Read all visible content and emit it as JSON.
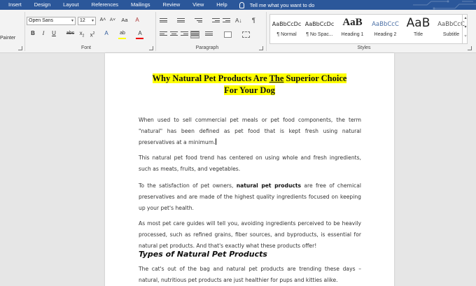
{
  "menu": {
    "tabs": [
      "Insert",
      "Design",
      "Layout",
      "References",
      "Mailings",
      "Review",
      "View",
      "Help"
    ],
    "tell_me": "Tell me what you want to do"
  },
  "ribbon": {
    "painter_label": "Painter",
    "font": {
      "group_label": "Font",
      "family": "Open Sans",
      "size": "12",
      "grow": "A˄",
      "shrink": "A˅",
      "case": "Aa",
      "clear": "A",
      "bold": "B",
      "italic": "I",
      "underline": "U",
      "strike": "abc",
      "subscript_base": "x",
      "subscript": "2",
      "superscript": "2",
      "text_effects": "A",
      "highlight": "ab",
      "font_color": "A"
    },
    "paragraph": {
      "group_label": "Paragraph",
      "sort": "A↓",
      "pilcrow": "¶"
    },
    "styles": {
      "group_label": "Styles",
      "items": [
        {
          "sample": "AaBbCcDc",
          "name": "¶ Normal"
        },
        {
          "sample": "AaBbCcDc",
          "name": "¶ No Spac..."
        },
        {
          "sample": "AaB",
          "name": "Heading 1"
        },
        {
          "sample": "AaBbCcC",
          "name": "Heading 2"
        },
        {
          "sample": "AaB",
          "name": "Title"
        },
        {
          "sample": "AaBbCcC",
          "name": "Subtitle"
        }
      ]
    }
  },
  "colors": {
    "accent": "#2b579a",
    "highlight": "#ffff00",
    "font_color": "#e00000"
  },
  "document": {
    "title_line1_a": "Why Natural Pet Products Are ",
    "title_line1_u": "The",
    "title_line1_b": " Superior Choice",
    "title_line2": "For Your Dog",
    "p1": "When used to sell commercial pet meals or pet food components, the term \"natural\" has been defined as pet food that is kept fresh using natural preservatives at a minimum.",
    "p2": "This natural pet food trend has centered on using whole and fresh ingredients, such as meats, fruits, and vegetables.",
    "p3_a": "To the satisfaction of pet owners, ",
    "p3_b": "natural pet products",
    "p3_c": " are free of chemical preservatives and are made of the highest quality ingredients focused on keeping up your pet's health.",
    "p4": "As most pet care guides will tell you, avoiding ingredients perceived to be heavily processed, such as refined grains, fiber sources, and byproducts, is essential for natural pet products. And that's exactly what these products offer!",
    "h2": "Types of Natural Pet Products",
    "p5": "The cat's out of the bag and natural pet products are trending these days – natural, nutritious pet products are just healthier for pups and kitties alike."
  }
}
